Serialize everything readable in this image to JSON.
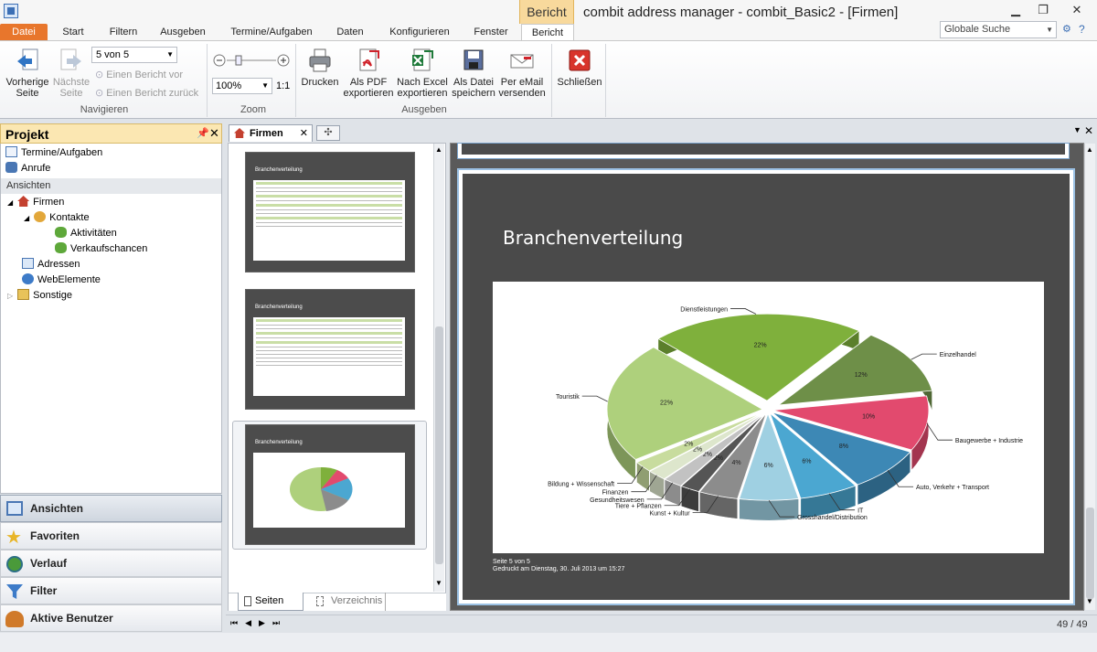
{
  "window": {
    "context_tab": "Bericht",
    "title": "combit address manager - combit_Basic2 - [Firmen]",
    "search_placeholder": "Globale Suche"
  },
  "tabs": [
    "Datei",
    "Start",
    "Filtern",
    "Ausgeben",
    "Termine/Aufgaben",
    "Daten",
    "Konfigurieren",
    "Fenster",
    "Bericht"
  ],
  "ribbon": {
    "prev_page": "Vorherige\nSeite",
    "next_page": "Nächste\nSeite",
    "page_select": "5 von 5",
    "prev_report": "Einen Bericht vor",
    "next_report": "Einen Bericht zurück",
    "group_navigate": "Navigieren",
    "zoom_value": "100%",
    "zoom_ratio": "1:1",
    "group_zoom": "Zoom",
    "print": "Drucken",
    "export_pdf": "Als PDF\nexportieren",
    "export_excel": "Nach Excel\nexportieren",
    "save_file": "Als Datei\nspeichern",
    "send_email": "Per eMail\nversenden",
    "group_output": "Ausgeben",
    "close": "Schließen"
  },
  "left_panel": {
    "title": "Projekt",
    "items": [
      "Termine/Aufgaben",
      "Anrufe"
    ],
    "section": "Ansichten",
    "tree": [
      "Firmen",
      "Kontakte",
      "Aktivitäten",
      "Verkaufschancen",
      "Adressen",
      "WebElemente",
      "Sonstige"
    ]
  },
  "nav": [
    "Ansichten",
    "Favoriten",
    "Verlauf",
    "Filter",
    "Aktive Benutzer"
  ],
  "doc_tab": "Firmen",
  "thumb_tabs": [
    "Seiten",
    "Verzeichnis"
  ],
  "thumb_title": "Branchenverteilung",
  "page": {
    "title": "Branchenverteilung",
    "footer_page": "Seite 5 von 5",
    "footer_printed": "Gedruckt am Dienstag, 30. Juli 2013 um 15:27"
  },
  "status_counter": "49 / 49",
  "chart_data": {
    "type": "pie",
    "title": "Branchenverteilung",
    "series": [
      {
        "label": "Dienstleistungen",
        "pct_label": "22%",
        "value": 22,
        "color": "#7fb03c"
      },
      {
        "label": "Einzelhandel",
        "pct_label": "12%",
        "value": 12,
        "color": "#6e8f48"
      },
      {
        "label": "Baugewerbe + Industrie",
        "pct_label": "10%",
        "value": 10,
        "color": "#e24a6e"
      },
      {
        "label": "Auto, Verkehr + Transport",
        "pct_label": "8%",
        "value": 8,
        "color": "#3d88b5"
      },
      {
        "label": "IT",
        "pct_label": "6%",
        "value": 6,
        "color": "#4ba7d1"
      },
      {
        "label": "Grosshandel/Distribution",
        "pct_label": "6%",
        "value": 6,
        "color": "#9fd0e2"
      },
      {
        "label": "Kunst + Kultur",
        "pct_label": "4%",
        "value": 4,
        "color": "#8c8c8c"
      },
      {
        "label": "Tiere + Pflanzen",
        "pct_label": "2%",
        "value": 2,
        "color": "#555555"
      },
      {
        "label": "Gesundheitswesen",
        "pct_label": "2%",
        "value": 2,
        "color": "#c2c2c2"
      },
      {
        "label": "Finanzen",
        "pct_label": "2%",
        "value": 2,
        "color": "#dde6cc"
      },
      {
        "label": "Bildung + Wissenschaft",
        "pct_label": "2%",
        "value": 2,
        "color": "#c8dc9e"
      },
      {
        "label": "Touristik",
        "pct_label": "22%",
        "value": 22,
        "color": "#aed07c"
      }
    ]
  }
}
